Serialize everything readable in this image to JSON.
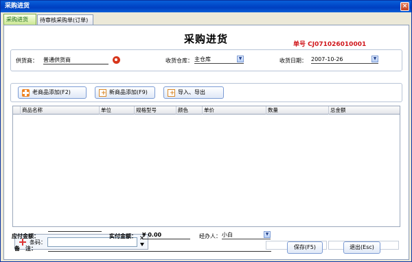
{
  "window": {
    "title": "采购进货",
    "close_glyph": "×"
  },
  "tabs": [
    {
      "label": "采购进货",
      "active": true
    },
    {
      "label": "待审核采购单(订单)",
      "active": false
    }
  ],
  "header": {
    "title": "采购进货",
    "order_no": "单号 CJ071026010001"
  },
  "form": {
    "supplier_label": "供货商：",
    "supplier_value": "普通供货商",
    "warehouse_label": "收货仓库：",
    "warehouse_value": "主仓库",
    "date_label": "收货日期：",
    "date_value": "2007-10-26"
  },
  "toolbar": {
    "add_existing": "老商品添加(F2)",
    "add_new": "新商品添加(F9)",
    "import_export": "导入、导出"
  },
  "grid": {
    "columns": [
      "商品名称",
      "单位",
      "规格型号",
      "颜色",
      "单价",
      "数量",
      "总金额"
    ],
    "rows": []
  },
  "barcode": {
    "label": "条码：",
    "value": ""
  },
  "footer": {
    "payable_label": "应付金额：",
    "payable_value": "",
    "paid_label": "实付金额：",
    "paid_value": "¥ 0.00",
    "handler_label": "经办人：",
    "handler_value": "小白",
    "note_label": "备　注：",
    "note_value": "",
    "save_button": "保存(F5)",
    "exit_button": "退出(Esc)"
  },
  "colors": {
    "order_no": "#d0161b",
    "titlebar": "#0149c9",
    "accent_tab": "#c8e68c"
  }
}
